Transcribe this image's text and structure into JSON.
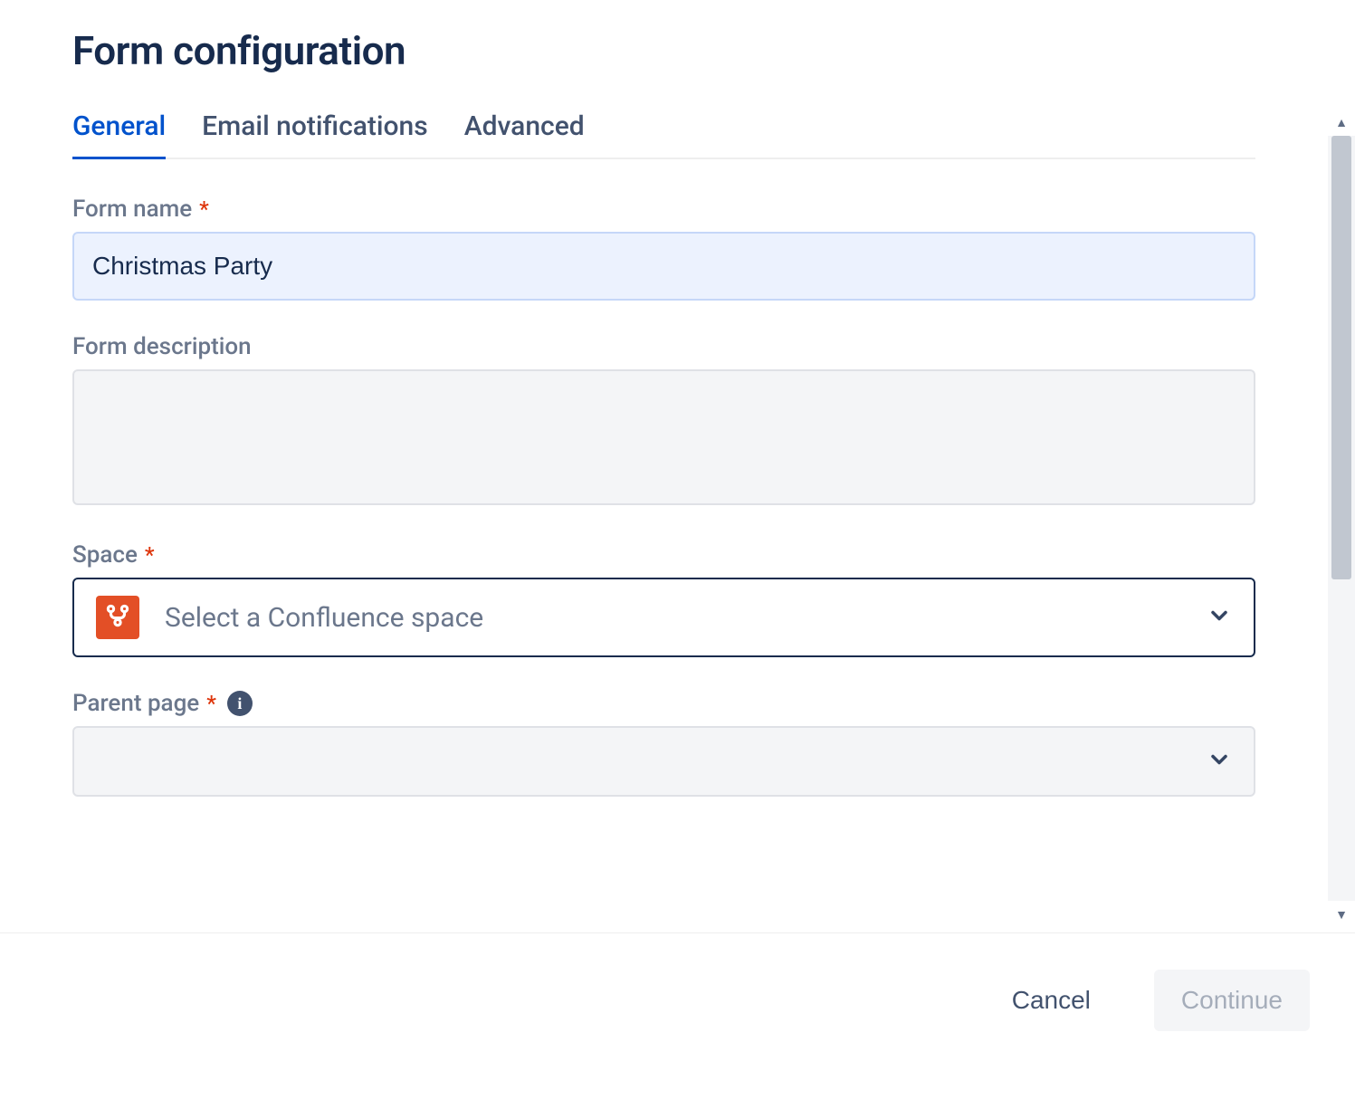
{
  "page_title": "Form configuration",
  "tabs": [
    {
      "label": "General",
      "active": true
    },
    {
      "label": "Email notifications",
      "active": false
    },
    {
      "label": "Advanced",
      "active": false
    }
  ],
  "fields": {
    "form_name": {
      "label": "Form name",
      "required": true,
      "value": "Christmas Party"
    },
    "form_description": {
      "label": "Form description",
      "required": false,
      "value": ""
    },
    "space": {
      "label": "Space",
      "required": true,
      "placeholder": "Select a Confluence space",
      "icon": "git-branch-icon",
      "icon_bg": "#E34F26"
    },
    "parent_page": {
      "label": "Parent page",
      "required": true,
      "info": true,
      "placeholder": ""
    }
  },
  "footer": {
    "cancel_label": "Cancel",
    "continue_label": "Continue"
  }
}
